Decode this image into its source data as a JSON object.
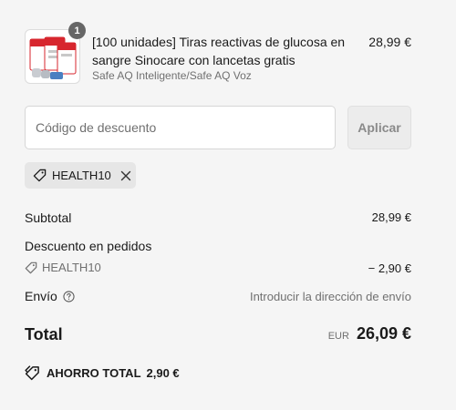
{
  "product": {
    "quantity": "1",
    "title": "[100 unidades] Tiras reactivas de glucosa en sangre Sinocare con lancetas gratis",
    "variant": "Safe AQ Inteligente/Safe AQ Voz",
    "price": "28,99 €",
    "image_icon": "glucose-test-strips-box"
  },
  "discount": {
    "placeholder": "Código de descuento",
    "value": "",
    "apply_label": "Aplicar",
    "applied_code": "HEALTH10"
  },
  "summary": {
    "subtotal_label": "Subtotal",
    "subtotal_value": "28,99 €",
    "order_discount_label": "Descuento en pedidos",
    "discount_code": "HEALTH10",
    "discount_value": "− 2,90 €",
    "shipping_label": "Envío",
    "shipping_value": "Introducir la dirección de envío",
    "total_label": "Total",
    "currency": "EUR",
    "total_value": "26,09 €",
    "savings_label": "AHORRO TOTAL",
    "savings_value": "2,90 €"
  },
  "colors": {
    "background": "#f5f5f5",
    "text": "#1a1a1a",
    "muted": "#707070",
    "badge": "#666666",
    "brand_red": "#d7262e"
  }
}
